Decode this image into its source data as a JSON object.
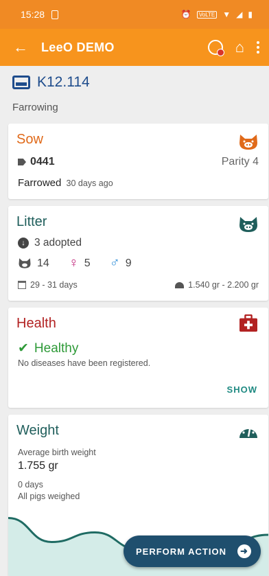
{
  "status_bar": {
    "time": "15:28",
    "volte": "VoLTE"
  },
  "app_bar": {
    "title": "LeeO DEMO",
    "back_icon": "back-arrow-icon",
    "sync_icon": "sync-alert-icon",
    "home_icon": "home-icon",
    "menu_icon": "more-vert-icon"
  },
  "pen": {
    "id": "K12.114",
    "stage": "Farrowing"
  },
  "sow": {
    "title": "Sow",
    "tag": "0441",
    "parity": "Parity 4",
    "status": "Farrowed",
    "status_since": "30 days ago"
  },
  "litter": {
    "title": "Litter",
    "adopted": "3 adopted",
    "piglets": "14",
    "females": "5",
    "males": "9",
    "age": "29 - 31 days",
    "weight_range": "1.540 gr - 2.200 gr"
  },
  "health": {
    "title": "Health",
    "status": "Healthy",
    "description": "No diseases have been registered.",
    "show_label": "SHOW"
  },
  "weight": {
    "title": "Weight",
    "avg_label": "Average birth weight",
    "avg_value": "1.755 gr",
    "days": "0 days",
    "all_weighed": "All pigs weighed",
    "chart_values": [
      0.85,
      0.35,
      0.55,
      0.2,
      0.45,
      0.3,
      0.5
    ]
  },
  "fab": {
    "label": "PERFORM ACTION"
  },
  "colors": {
    "status_bar": "#f08a24",
    "app_bar": "#f7941d",
    "sow": "#e06a1a",
    "litter": "#1f5e5b",
    "health": "#b22222",
    "healthy": "#2e9a38",
    "fab": "#1f4f6e"
  }
}
